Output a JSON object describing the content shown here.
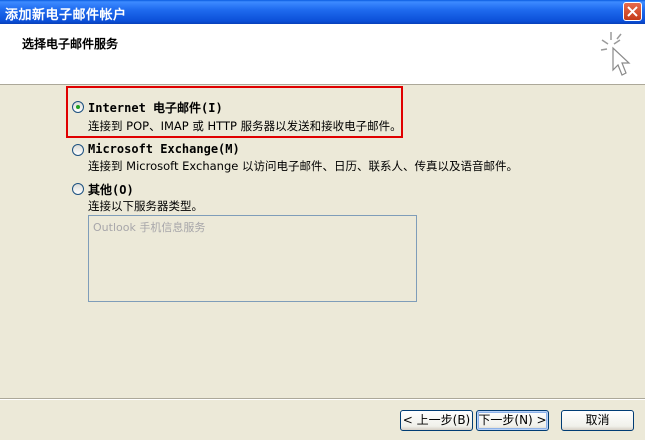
{
  "window": {
    "title": "添加新电子邮件帐户"
  },
  "header": {
    "title": "选择电子邮件服务"
  },
  "options": [
    {
      "label": "Internet 电子邮件(I)",
      "description": "连接到 POP、IMAP 或 HTTP 服务器以发送和接收电子邮件。",
      "checked": true
    },
    {
      "label": "Microsoft Exchange(M)",
      "description": "连接到 Microsoft Exchange 以访问电子邮件、日历、联系人、传真以及语音邮件。",
      "checked": false
    },
    {
      "label": "其他(O)",
      "description": "连接以下服务器类型。",
      "checked": false
    }
  ],
  "other_servers": {
    "items": [
      "Outlook 手机信息服务"
    ]
  },
  "footer": {
    "back_label": "< 上一步(B)",
    "next_label": "下一步(N) >",
    "cancel_label": "取消"
  },
  "colors": {
    "highlight": "#E00000",
    "titlebar": "#0A5BE0"
  }
}
